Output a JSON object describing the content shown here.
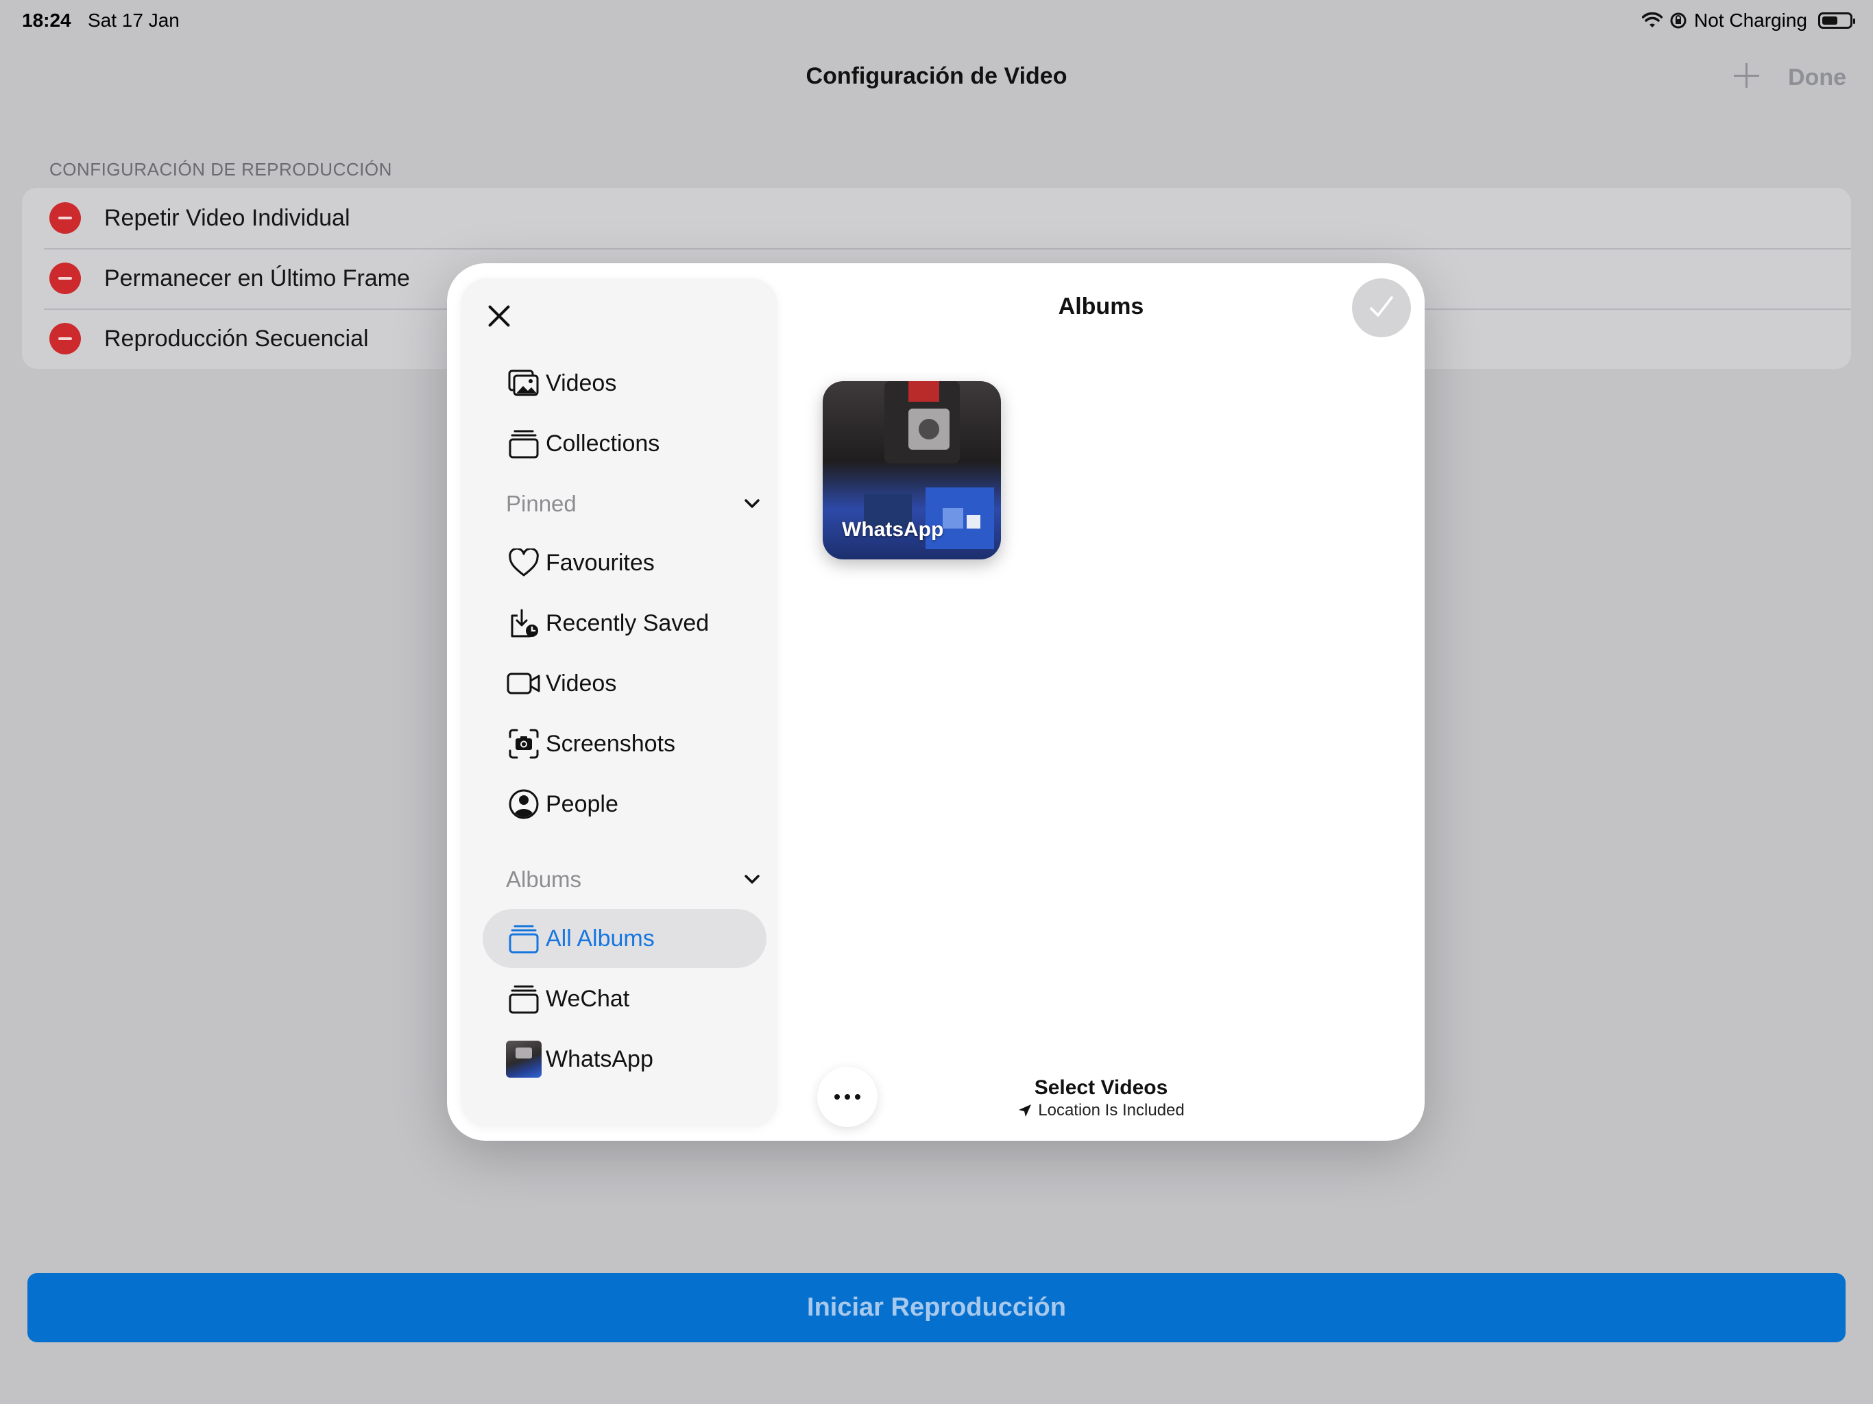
{
  "status_bar": {
    "time": "18:24",
    "date": "Sat 17 Jan",
    "battery_status": "Not Charging",
    "icons": [
      "wifi-icon",
      "orientation-lock-icon",
      "battery-icon"
    ]
  },
  "nav": {
    "title": "Configuración de Video",
    "add_icon": "plus-icon",
    "done_label": "Done"
  },
  "settings": {
    "section_header": "CONFIGURACIÓN DE REPRODUCCIÓN",
    "rows": [
      {
        "label": "Repetir Video Individual",
        "icon": "minus-circle-icon"
      },
      {
        "label": "Permanecer en Último Frame",
        "icon": "minus-circle-icon"
      },
      {
        "label": "Reproducción Secuencial",
        "icon": "minus-circle-icon"
      }
    ]
  },
  "start_button_label": "Iniciar Reproducción",
  "picker": {
    "title": "Albums",
    "confirm_icon": "checkmark-icon",
    "close_icon": "close-icon",
    "top_items": [
      {
        "label": "Videos",
        "icon": "photo-library-icon"
      },
      {
        "label": "Collections",
        "icon": "stack-icon"
      }
    ],
    "pinned": {
      "header": "Pinned",
      "items": [
        {
          "label": "Favourites",
          "icon": "heart-icon"
        },
        {
          "label": "Recently Saved",
          "icon": "download-clock-icon"
        },
        {
          "label": "Videos",
          "icon": "video-camera-icon"
        },
        {
          "label": "Screenshots",
          "icon": "screenshot-icon"
        },
        {
          "label": "People",
          "icon": "person-circle-icon"
        }
      ]
    },
    "albums": {
      "header": "Albums",
      "items": [
        {
          "label": "All Albums",
          "icon": "stack-icon",
          "selected": true
        },
        {
          "label": "WeChat",
          "icon": "stack-icon"
        },
        {
          "label": "WhatsApp",
          "icon": "album-thumbnail"
        }
      ]
    },
    "grid": [
      {
        "label": "WhatsApp"
      }
    ],
    "footer": {
      "title": "Select Videos",
      "subtitle": "Location Is Included",
      "location_icon": "location-arrow-icon",
      "more_icon": "ellipsis-icon"
    }
  },
  "colors": {
    "accent": "#1676e0",
    "primary_button": "#0570ce",
    "destructive": "#cc2a2d",
    "dimmed_background": "#c3c3c6"
  }
}
